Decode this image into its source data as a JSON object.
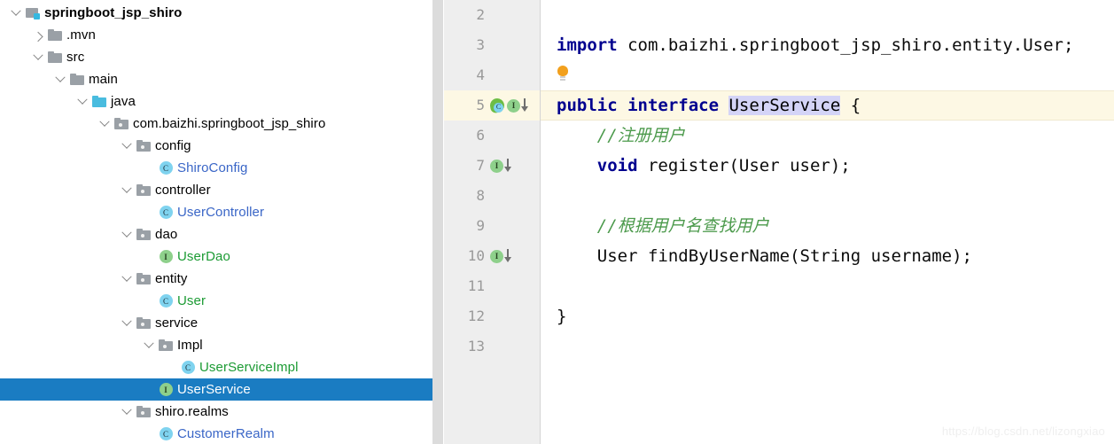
{
  "project_tree": {
    "panel_name": "Project",
    "selected_path": "UserService",
    "selection_color": "#1a7cc2",
    "items": [
      {
        "label": "springboot_jsp_shiro",
        "indent": 0,
        "arrow": "expanded",
        "icon": "module-folder-icon",
        "style": "bold"
      },
      {
        "label": ".mvn",
        "indent": 1,
        "arrow": "collapsed",
        "icon": "folder-icon",
        "style": "plain"
      },
      {
        "label": "src",
        "indent": 1,
        "arrow": "expanded",
        "icon": "folder-icon",
        "style": "plain"
      },
      {
        "label": "main",
        "indent": 2,
        "arrow": "expanded",
        "icon": "folder-icon",
        "style": "plain"
      },
      {
        "label": "java",
        "indent": 3,
        "arrow": "expanded",
        "icon": "source-root-folder-icon",
        "style": "plain"
      },
      {
        "label": "com.baizhi.springboot_jsp_shiro",
        "indent": 4,
        "arrow": "expanded",
        "icon": "package-icon",
        "style": "plain"
      },
      {
        "label": "config",
        "indent": 5,
        "arrow": "expanded",
        "icon": "package-icon",
        "style": "plain"
      },
      {
        "label": "ShiroConfig",
        "indent": 6,
        "arrow": "none",
        "icon": "class-icon",
        "style": "blue"
      },
      {
        "label": "controller",
        "indent": 5,
        "arrow": "expanded",
        "icon": "package-icon",
        "style": "plain"
      },
      {
        "label": "UserController",
        "indent": 6,
        "arrow": "none",
        "icon": "class-icon",
        "style": "blue"
      },
      {
        "label": "dao",
        "indent": 5,
        "arrow": "expanded",
        "icon": "package-icon",
        "style": "plain"
      },
      {
        "label": "UserDao",
        "indent": 6,
        "arrow": "none",
        "icon": "interface-icon",
        "style": "green"
      },
      {
        "label": "entity",
        "indent": 5,
        "arrow": "expanded",
        "icon": "package-icon",
        "style": "plain"
      },
      {
        "label": "User",
        "indent": 6,
        "arrow": "none",
        "icon": "class-icon",
        "style": "green"
      },
      {
        "label": "service",
        "indent": 5,
        "arrow": "expanded",
        "icon": "package-icon",
        "style": "plain"
      },
      {
        "label": "Impl",
        "indent": 6,
        "arrow": "expanded",
        "icon": "package-icon",
        "style": "plain"
      },
      {
        "label": "UserServiceImpl",
        "indent": 7,
        "arrow": "none",
        "icon": "class-icon",
        "style": "green"
      },
      {
        "label": "UserService",
        "indent": 6,
        "arrow": "none",
        "icon": "interface-icon",
        "style": "selected"
      },
      {
        "label": "shiro.realms",
        "indent": 5,
        "arrow": "expanded",
        "icon": "package-icon",
        "style": "plain"
      },
      {
        "label": "CustomerRealm",
        "indent": 6,
        "arrow": "none",
        "icon": "class-icon",
        "style": "blue"
      }
    ]
  },
  "editor": {
    "file_name": "UserService",
    "current_line": 5,
    "current_line_color": "#fdf8e4",
    "identifier_highlight_color": "#d4d4f7",
    "keyword_color": "#00008f",
    "comment_color": "#4c9a4c",
    "lines": [
      {
        "num": "2",
        "tokens": [],
        "gutter": []
      },
      {
        "num": "3",
        "tokens": [
          {
            "t": "import ",
            "c": "kw"
          },
          {
            "t": "com.baizhi.springboot_jsp_shiro.entity.User;",
            "c": "plain"
          }
        ],
        "gutter": []
      },
      {
        "num": "4",
        "tokens": [],
        "gutter": [
          "intention-bulb-icon"
        ]
      },
      {
        "num": "5",
        "tokens": [
          {
            "t": "public interface ",
            "c": "kw"
          },
          {
            "t": "UserService",
            "c": "ident-hl"
          },
          {
            "t": " {",
            "c": "plain"
          }
        ],
        "gutter": [
          "spring-bean-icon",
          "implemented-by-icon"
        ]
      },
      {
        "num": "6",
        "tokens": [
          {
            "t": "    //注册用户",
            "c": "cmt"
          }
        ],
        "gutter": []
      },
      {
        "num": "7",
        "tokens": [
          {
            "t": "    void ",
            "c": "kw"
          },
          {
            "t": "register(User user);",
            "c": "plain"
          }
        ],
        "gutter": [
          "implemented-by-icon"
        ]
      },
      {
        "num": "8",
        "tokens": [],
        "gutter": []
      },
      {
        "num": "9",
        "tokens": [
          {
            "t": "    //根据用户名查找用户",
            "c": "cmt"
          }
        ],
        "gutter": []
      },
      {
        "num": "10",
        "tokens": [
          {
            "t": "    User findByUserName(String username);",
            "c": "plain"
          }
        ],
        "gutter": [
          "implemented-by-icon"
        ]
      },
      {
        "num": "11",
        "tokens": [],
        "gutter": []
      },
      {
        "num": "12",
        "tokens": [
          {
            "t": "}",
            "c": "plain"
          }
        ],
        "gutter": []
      },
      {
        "num": "13",
        "tokens": [],
        "gutter": []
      }
    ]
  },
  "watermark": {
    "text": "https://blog.csdn.net/lizongxiao"
  }
}
